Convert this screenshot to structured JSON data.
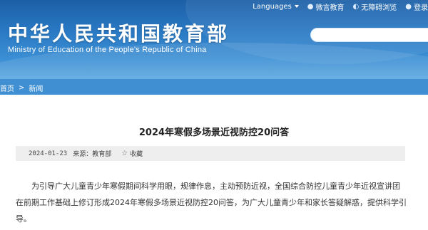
{
  "header": {
    "title": "中华人民共和国教育部",
    "subtitle": "Ministry of Education of the People's Republic of China",
    "colors": {
      "primary": "#1c5fa6",
      "accent": "#3f8fd2"
    }
  },
  "topbar": {
    "languages": "Languages",
    "wechat": "微言教育",
    "accessibility": "无障碍浏览",
    "login": "登录"
  },
  "search": {
    "placeholder": ""
  },
  "breadcrumb": {
    "home": "首页",
    "sep": ">",
    "news": "新闻"
  },
  "article": {
    "title": "2024年寒假多场景近视防控20问答",
    "date": "2024-01-23",
    "source": "来源：教育部",
    "favorite": "收藏",
    "body": "为引导广大儿童青少年寒假期间科学用眼，规律作息，主动预防近视，全国综合防控儿童青少年近视宣讲团在前期工作基础上修订形成2024年寒假多场景近视防控20问答，为广大儿童青少年和家长答疑解惑，提供科学引导。"
  },
  "icons": {
    "wechat": "wechat-icon",
    "accessibility": "accessibility-icon",
    "login": "user-icon",
    "favorite": "star-icon",
    "dropdown": "caret-down-icon"
  }
}
